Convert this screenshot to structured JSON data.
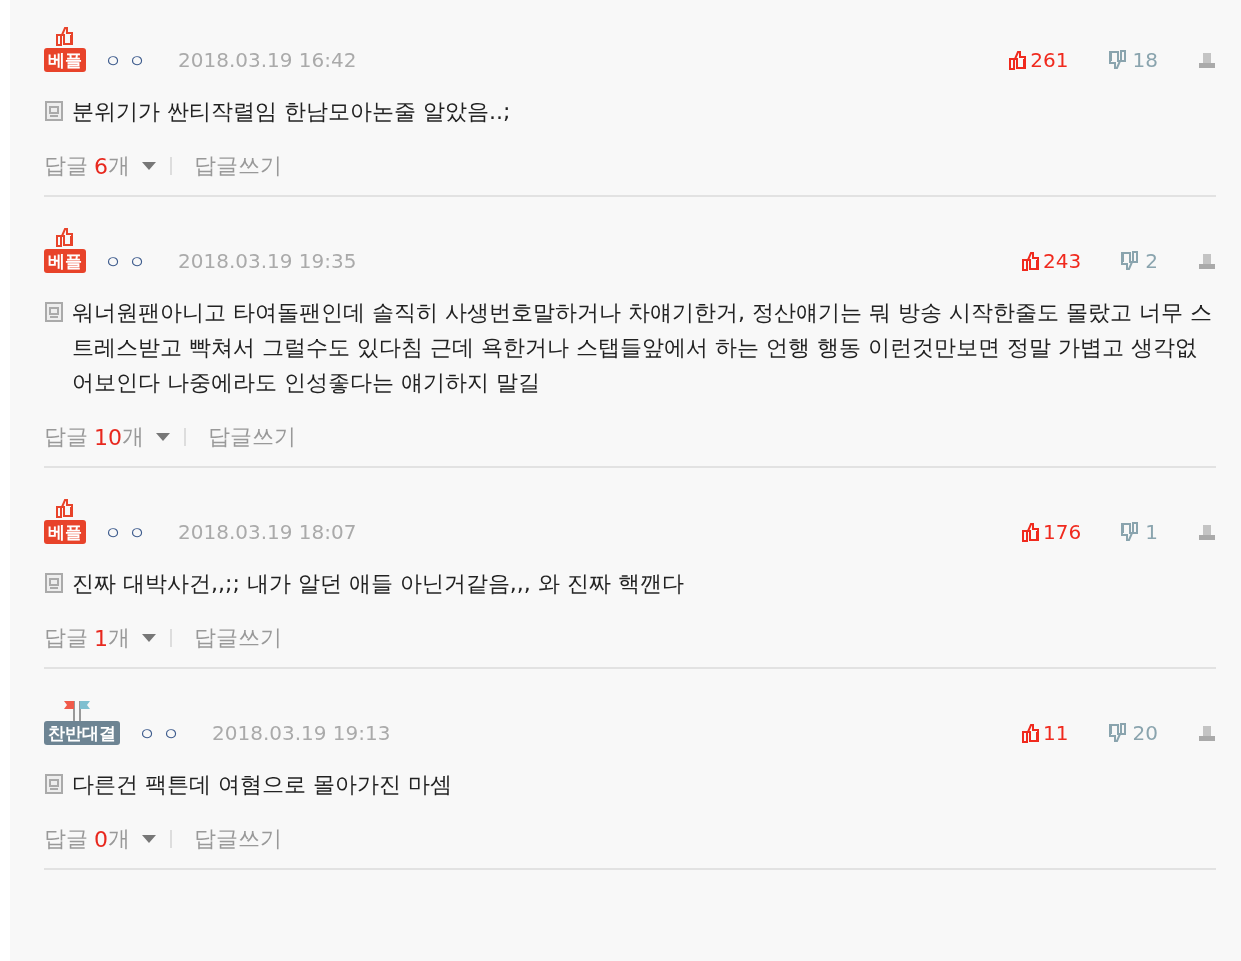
{
  "comments": [
    {
      "badge": {
        "kind": "best",
        "label": "베플"
      },
      "author": "ㅇㅇ",
      "date": "2018.03.19 16:42",
      "likes": "261",
      "dislikes": "18",
      "text": "분위기가 싼티작렬임 한남모아논줄 알았음..;",
      "replies": {
        "label": "답글",
        "count": "6",
        "unit": "개"
      },
      "write_reply": "답글쓰기"
    },
    {
      "badge": {
        "kind": "best",
        "label": "베플"
      },
      "author": "ㅇㅇ",
      "date": "2018.03.19 19:35",
      "likes": "243",
      "dislikes": "2",
      "text": "워너원팬아니고 타여돌팬인데 솔직히 사생번호말하거나 차얘기한거, 정산얘기는 뭐 방송 시작한줄도 몰랐고 너무 스트레스받고 빡쳐서 그럴수도 있다침 근데 욕한거나 스탭들앞에서 하는 언행 행동 이런것만보면 정말 가볍고 생각없어보인다 나중에라도 인성좋다는 얘기하지 말길",
      "replies": {
        "label": "답글",
        "count": "10",
        "unit": "개"
      },
      "write_reply": "답글쓰기"
    },
    {
      "badge": {
        "kind": "best",
        "label": "베플"
      },
      "author": "ㅇㅇ",
      "date": "2018.03.19 18:07",
      "likes": "176",
      "dislikes": "1",
      "text": "진짜 대박사건,,;; 내가 알던 애들 아닌거같음,,, 와 진짜 핵깬다",
      "replies": {
        "label": "답글",
        "count": "1",
        "unit": "개"
      },
      "write_reply": "답글쓰기"
    },
    {
      "badge": {
        "kind": "versus",
        "label": "찬반대결"
      },
      "author": "ㅇㅇ",
      "date": "2018.03.19 19:13",
      "likes": "11",
      "dislikes": "20",
      "text": "다른건 팩튼데 여혐으로 몰아가진 마셈",
      "replies": {
        "label": "답글",
        "count": "0",
        "unit": "개"
      },
      "write_reply": "답글쓰기"
    }
  ]
}
